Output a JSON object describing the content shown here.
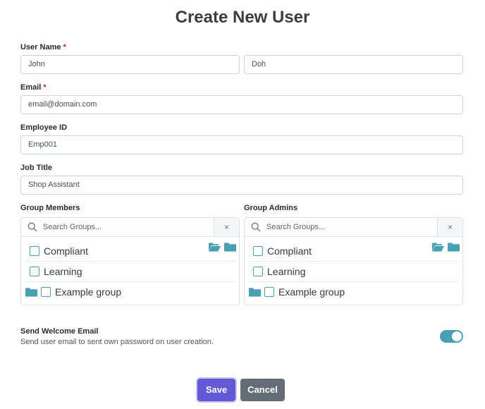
{
  "page": {
    "title": "Create New User"
  },
  "form": {
    "user_name": {
      "label": "User Name",
      "required_mark": "*",
      "first": "John",
      "last": "Doh"
    },
    "email": {
      "label": "Email",
      "required_mark": "*",
      "value": "email@domain.com"
    },
    "employee_id": {
      "label": "Employee ID",
      "value": "Emp001"
    },
    "job_title": {
      "label": "Job Title",
      "value": "Shop Assistant"
    }
  },
  "groups": {
    "members": {
      "label": "Group Members",
      "search_placeholder": "Search Groups...",
      "clear_label": "×",
      "items": [
        {
          "label": "Compliant",
          "checked": false
        },
        {
          "label": "Learning",
          "checked": false
        },
        {
          "label": "Example group",
          "checked": false,
          "has_folder": true
        }
      ]
    },
    "admins": {
      "label": "Group Admins",
      "search_placeholder": "Search Groups...",
      "clear_label": "×",
      "items": [
        {
          "label": "Compliant",
          "checked": false
        },
        {
          "label": "Learning",
          "checked": false
        },
        {
          "label": "Example group",
          "checked": false,
          "has_folder": true
        }
      ]
    },
    "icons": {
      "expand_all": "folder-open-icon",
      "collapse_all": "folder-icon"
    }
  },
  "welcome_email": {
    "title": "Send Welcome Email",
    "description": "Send user email to sent own password on user creation.",
    "enabled": true
  },
  "actions": {
    "save_label": "Save",
    "cancel_label": "Cancel"
  },
  "colors": {
    "accent": "#4a9fb5",
    "primary": "#6258d8",
    "secondary": "#646d75",
    "required": "#b4232c"
  }
}
